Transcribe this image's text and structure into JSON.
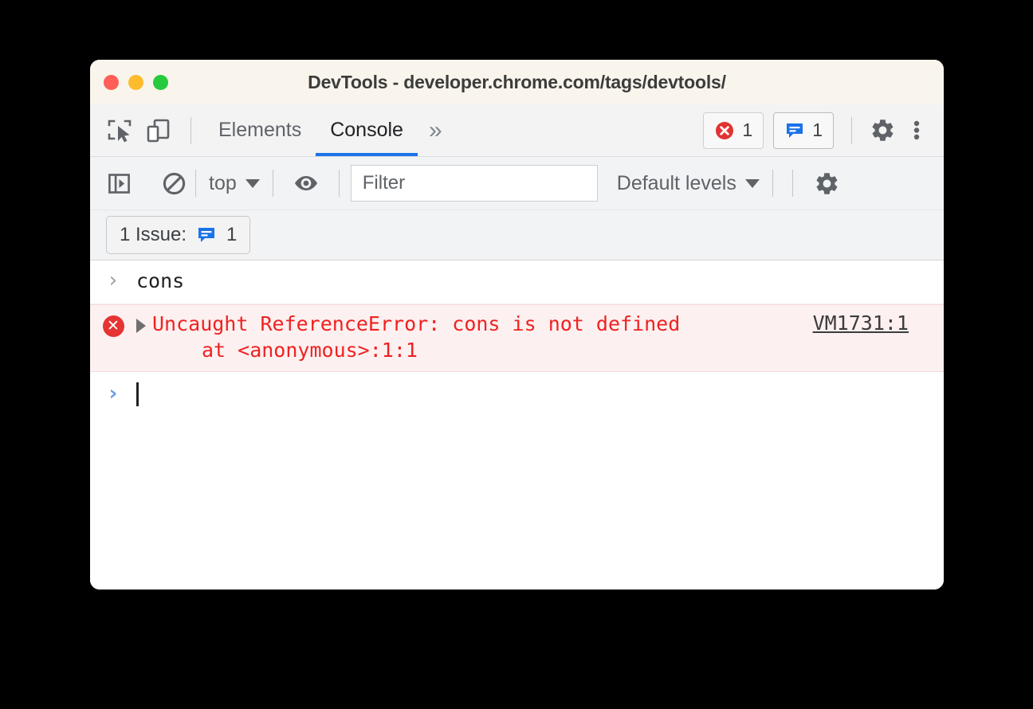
{
  "window": {
    "title": "DevTools - developer.chrome.com/tags/devtools/",
    "traffic_lights": [
      {
        "name": "close",
        "color": "#ff5f56"
      },
      {
        "name": "minimize",
        "color": "#fdbc2e"
      },
      {
        "name": "maximize",
        "color": "#27c93f"
      }
    ]
  },
  "tabbar": {
    "inspect_icon": "inspect-element-icon",
    "device_icon": "device-toolbar-icon",
    "tabs": [
      {
        "label": "Elements",
        "active": false
      },
      {
        "label": "Console",
        "active": true
      }
    ],
    "more_tabs_label": "»",
    "error_badge": {
      "icon": "error-circle-icon",
      "count": "1"
    },
    "issue_badge": {
      "icon": "issue-bubble-icon",
      "count": "1"
    },
    "settings_icon": "gear-icon",
    "menu_icon": "kebab-menu-icon"
  },
  "console_toolbar": {
    "sidebar_icon": "console-sidebar-toggle-icon",
    "clear_icon": "clear-console-icon",
    "context_label": "top",
    "eye_icon": "live-expression-eye-icon",
    "filter": {
      "value": "",
      "placeholder": "Filter"
    },
    "levels_label": "Default levels",
    "settings_icon": "gear-icon"
  },
  "issues_bar": {
    "label": "1 Issue:",
    "icon": "issue-bubble-icon",
    "count": "1"
  },
  "console": {
    "input_echo": {
      "prompt": "›",
      "text": "cons"
    },
    "error": {
      "icon": "error-circle-icon",
      "message": "Uncaught ReferenceError: cons is not defined",
      "stack": "at <anonymous>:1:1",
      "source_link": "VM1731:1"
    },
    "prompt": {
      "chevron": "›",
      "value": ""
    }
  },
  "colors": {
    "accent": "#1a73e8",
    "error": "#ef2222",
    "error_bg": "#fdf0f0",
    "issue_blue": "#1a73e8",
    "titlebar_bg": "#faf5ec"
  }
}
